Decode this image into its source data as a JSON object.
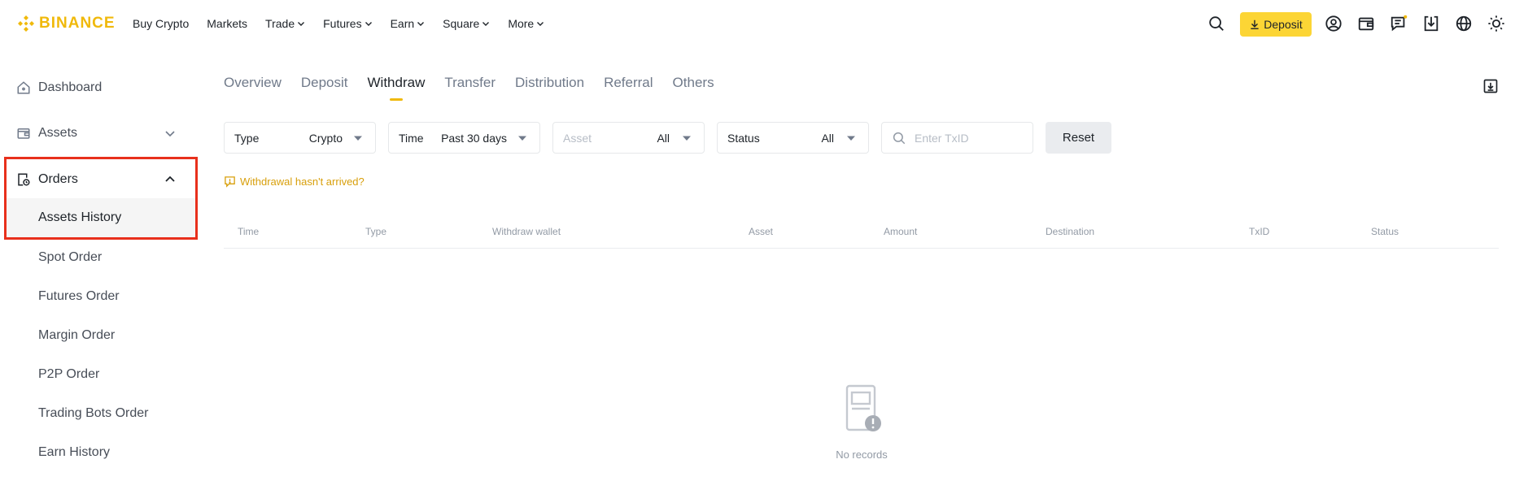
{
  "header": {
    "brand": "BINANCE",
    "nav": [
      {
        "label": "Buy Crypto",
        "has_dropdown": false
      },
      {
        "label": "Markets",
        "has_dropdown": false
      },
      {
        "label": "Trade",
        "has_dropdown": true
      },
      {
        "label": "Futures",
        "has_dropdown": true
      },
      {
        "label": "Earn",
        "has_dropdown": true
      },
      {
        "label": "Square",
        "has_dropdown": true
      },
      {
        "label": "More",
        "has_dropdown": true
      }
    ],
    "deposit_label": "Deposit",
    "icons": [
      "search-icon",
      "download-icon",
      "user-icon",
      "wallet-icon",
      "message-icon",
      "app-download-icon",
      "globe-icon",
      "theme-icon"
    ]
  },
  "sidebar": {
    "dashboard": "Dashboard",
    "assets": "Assets",
    "orders": "Orders",
    "sub_items": [
      "Assets History",
      "Spot Order",
      "Futures Order",
      "Margin Order",
      "P2P Order",
      "Trading Bots Order",
      "Earn History"
    ],
    "active_sub": "Assets History",
    "highlight_color": "#e8301c"
  },
  "tabs": [
    "Overview",
    "Deposit",
    "Withdraw",
    "Transfer",
    "Distribution",
    "Referral",
    "Others"
  ],
  "active_tab": "Withdraw",
  "filters": {
    "type": {
      "label": "Type",
      "value": "Crypto"
    },
    "time": {
      "label": "Time",
      "value": "Past 30 days"
    },
    "asset": {
      "label": "Asset",
      "value": "All"
    },
    "status": {
      "label": "Status",
      "value": "All"
    },
    "txid_placeholder": "Enter TxID",
    "reset_label": "Reset"
  },
  "notice": "Withdrawal hasn't arrived?",
  "table": {
    "columns": [
      "Time",
      "Type",
      "Withdraw wallet",
      "Asset",
      "Amount",
      "Destination",
      "TxID",
      "Status"
    ],
    "empty_text": "No records"
  },
  "colors": {
    "brand": "#f0b90b",
    "deposit_button": "#fcd535",
    "notice": "#d89f0b"
  }
}
